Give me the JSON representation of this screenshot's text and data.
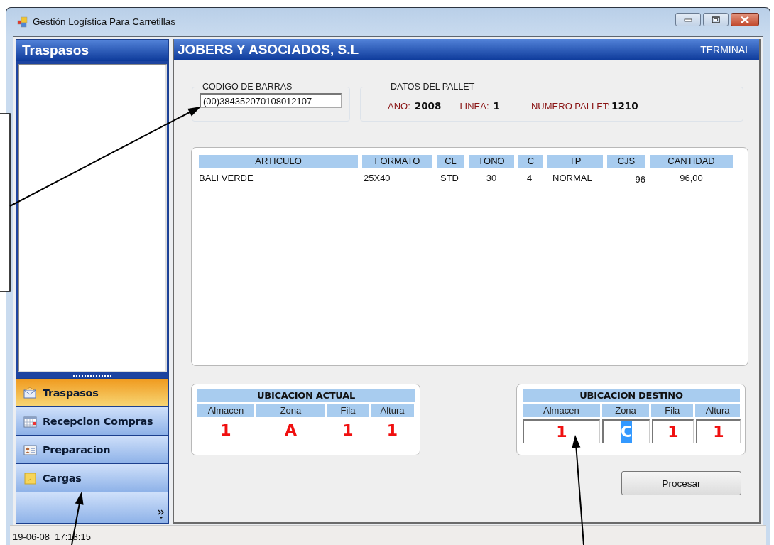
{
  "window": {
    "title": "Gestión Logística Para Carretillas"
  },
  "sidebar": {
    "title": "Traspasos",
    "nav_items": [
      {
        "label": "Traspasos",
        "kind": "envelope",
        "selected": true
      },
      {
        "label": "Recepcion Compras",
        "kind": "calendar",
        "selected": false
      },
      {
        "label": "Preparacion",
        "kind": "card",
        "selected": false
      },
      {
        "label": "Cargas",
        "kind": "note",
        "selected": false
      }
    ]
  },
  "header": {
    "company": "JOBERS Y ASOCIADOS, S.L",
    "terminal": "TERMINAL"
  },
  "barcode": {
    "label": "CODIGO DE BARRAS",
    "value": "(00)384352070108012107"
  },
  "pallet": {
    "label": "DATOS DEL PALLET",
    "fields": [
      {
        "label": "AÑO:",
        "value": "2008"
      },
      {
        "label": "LINEA:",
        "value": "1"
      },
      {
        "label": "NUMERO PALLET:",
        "value": "1210"
      }
    ]
  },
  "table": {
    "columns": [
      "ARTICULO",
      "FORMATO",
      "CL",
      "TONO",
      "C",
      "TP",
      "CJS",
      "CANTIDAD"
    ],
    "rows": [
      [
        "BALI VERDE",
        "25X40",
        "STD",
        "30",
        "4",
        "NORMAL",
        "96",
        "96,00"
      ]
    ]
  },
  "current_location": {
    "title": "UBICACION ACTUAL",
    "columns": [
      "Almacen",
      "Zona",
      "Fila",
      "Altura"
    ],
    "values": [
      "1",
      "A",
      "1",
      "1"
    ]
  },
  "destination_location": {
    "title": "UBICACION DESTINO",
    "columns": [
      "Almacen",
      "Zona",
      "Fila",
      "Altura"
    ],
    "fields": [
      {
        "value": "1",
        "selected": false
      },
      {
        "value": "C",
        "selected": true
      },
      {
        "value": "1",
        "selected": false
      },
      {
        "value": "1",
        "selected": false
      }
    ]
  },
  "button": "Procesar",
  "status_bar": {
    "text": "19-06-08  17:18:15"
  }
}
